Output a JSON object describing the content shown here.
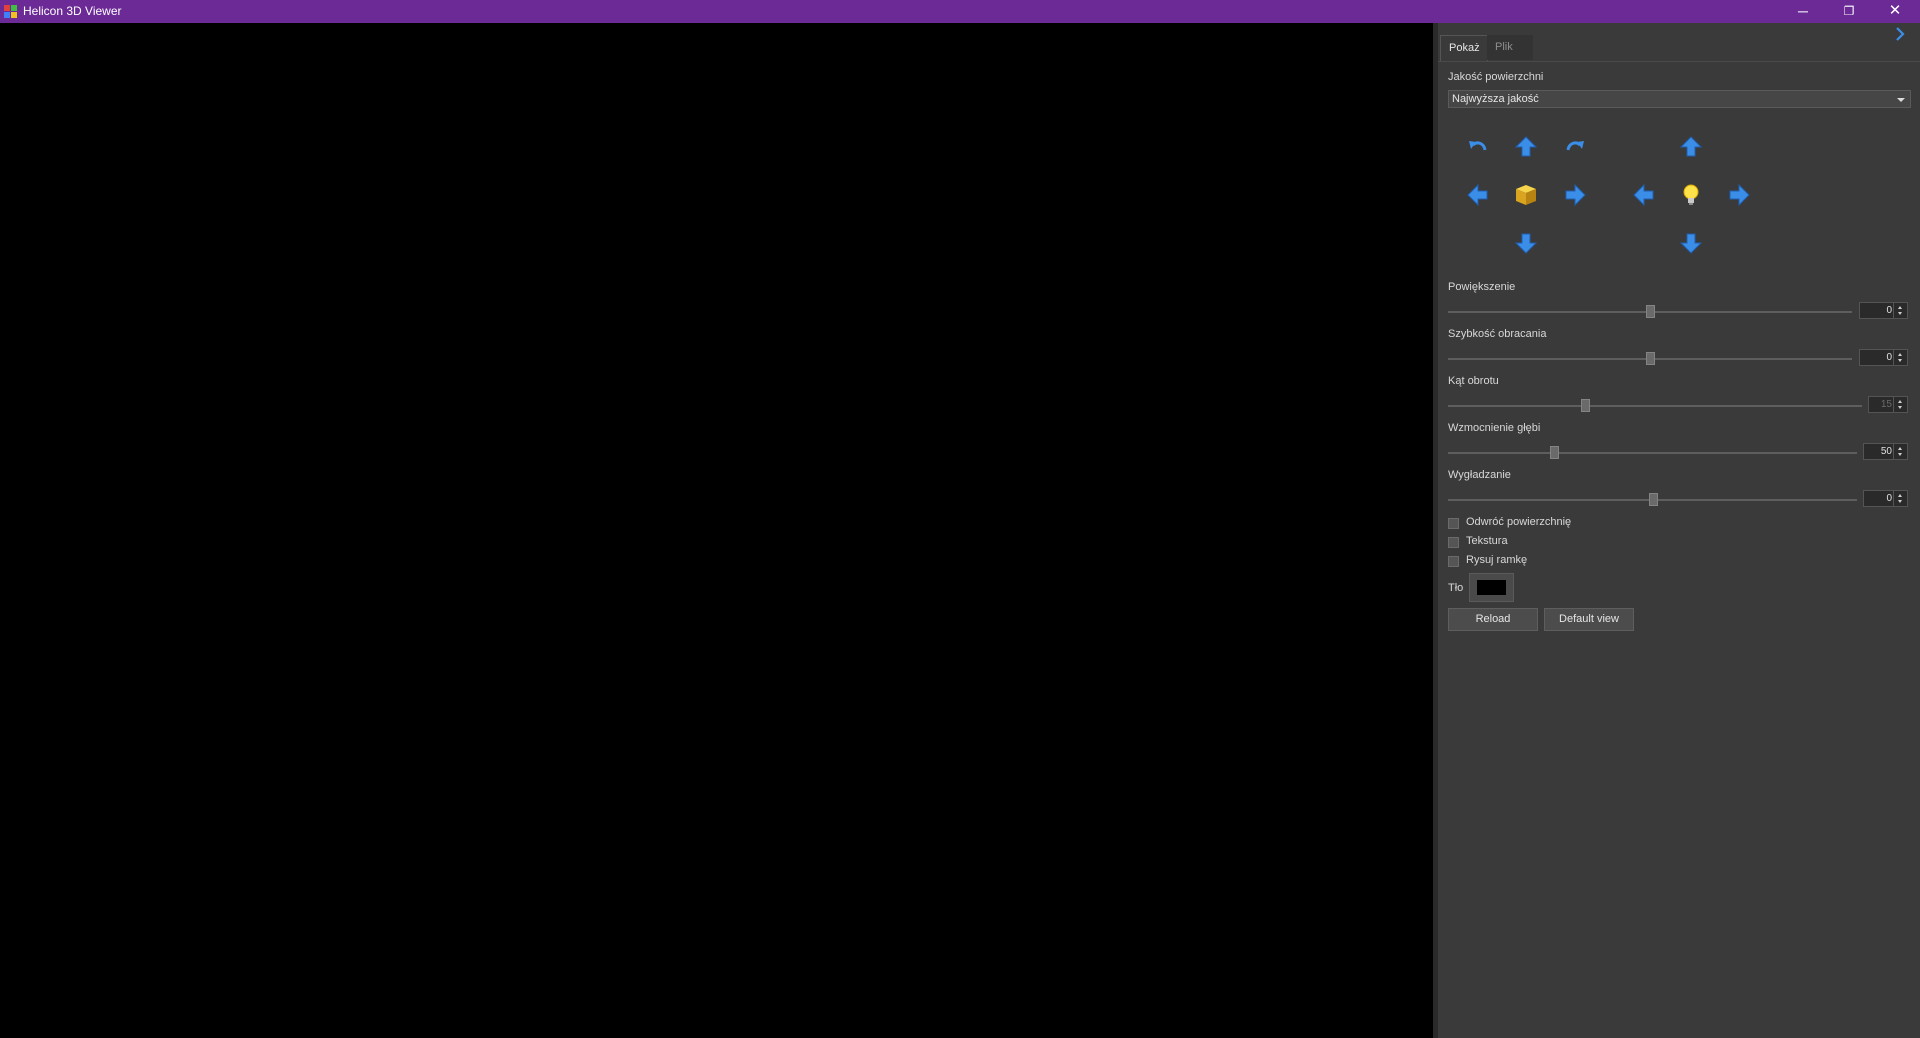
{
  "window": {
    "title": "Helicon 3D Viewer",
    "controls": {
      "minimize": "─",
      "restore": "❐",
      "close": "✕"
    }
  },
  "tabs": [
    {
      "label": "Pokaż",
      "active": true
    },
    {
      "label": "Plik",
      "active": false
    }
  ],
  "quality": {
    "label": "Jakość powierzchni",
    "selected": "Najwyższa jakość"
  },
  "navigation": {
    "model_controls": [
      "rotate-left-icon",
      "arrow-up-icon",
      "rotate-right-icon",
      "arrow-left-icon",
      "cube-icon",
      "arrow-right-icon",
      "arrow-down-icon"
    ],
    "light_controls": [
      "arrow-up-icon",
      "arrow-left-icon",
      "light-bulb-icon",
      "arrow-right-icon",
      "arrow-down-icon"
    ]
  },
  "sliders": [
    {
      "label": "Powiększenie",
      "value": "0",
      "level": 0.5,
      "enabled": true
    },
    {
      "label": "Szybkość obracania",
      "value": "0",
      "level": 0.5,
      "enabled": true
    },
    {
      "label": "Kąt obrotu",
      "value": "15",
      "level": 0.33,
      "enabled": false
    },
    {
      "label": "Wzmocnienie głębi",
      "value": "50",
      "level": 0.26,
      "enabled": true
    },
    {
      "label": "Wygładzanie",
      "value": "0",
      "level": 0.5,
      "enabled": true
    }
  ],
  "checkboxes": [
    {
      "label": "Odwróć powierzchnię",
      "checked": false
    },
    {
      "label": "Tekstura",
      "checked": false
    },
    {
      "label": "Rysuj ramkę",
      "checked": false
    }
  ],
  "background": {
    "label": "Tło",
    "color": "#000000"
  },
  "buttons": {
    "reload": "Reload",
    "default_view": "Default view"
  },
  "colors": {
    "titlebar": "#6b2a96",
    "panel": "#3a3a3a",
    "arrow_blue": "#3b8ee8"
  }
}
